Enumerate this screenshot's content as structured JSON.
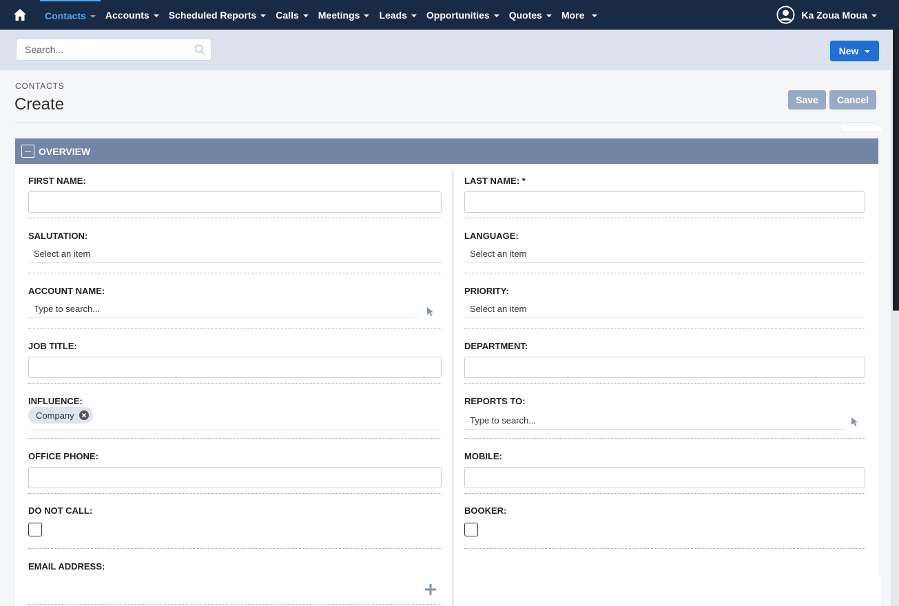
{
  "nav": {
    "items": [
      {
        "label": "Contacts",
        "active": true
      },
      {
        "label": "Accounts"
      },
      {
        "label": "Scheduled Reports"
      },
      {
        "label": "Calls"
      },
      {
        "label": "Meetings"
      },
      {
        "label": "Leads"
      },
      {
        "label": "Opportunities"
      },
      {
        "label": "Quotes"
      },
      {
        "label": "More"
      }
    ],
    "user_name": "Ka Zoua Moua",
    "home_icon": "home-icon",
    "user_icon": "user-circle-icon"
  },
  "search": {
    "placeholder": "Search..."
  },
  "new_button": "New",
  "header": {
    "module": "CONTACTS",
    "title": "Create",
    "save": "Save",
    "cancel": "Cancel"
  },
  "panel": {
    "title": "OVERVIEW"
  },
  "fields": {
    "first_name": "FIRST NAME:",
    "last_name": "LAST NAME:",
    "required_mark": "*",
    "salutation": "SALUTATION:",
    "salutation_value": "Select an item",
    "language": "LANGUAGE:",
    "language_value": "Select an item",
    "account_name": "ACCOUNT NAME:",
    "account_placeholder": "Type to search...",
    "priority": "PRIORITY:",
    "priority_value": "Select an item",
    "job_title": "JOB TITLE:",
    "department": "DEPARTMENT:",
    "influence": "INFLUENCE:",
    "influence_tag": "Company",
    "reports_to": "REPORTS TO:",
    "reports_placeholder": "Type to search...",
    "office_phone": "OFFICE PHONE:",
    "mobile": "MOBILE:",
    "do_not_call": "DO NOT CALL:",
    "booker": "BOOKER:",
    "email_address": "EMAIL ADDRESS:"
  },
  "colors": {
    "nav_bg": "#192a45",
    "accent": "#1f6fd6",
    "panel_header": "#7287a8",
    "disabled_button": "#99aac5"
  }
}
